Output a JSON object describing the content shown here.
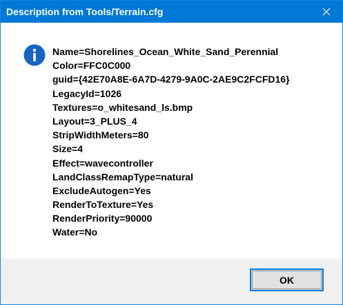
{
  "window": {
    "title": "Description from Tools/Terrain.cfg",
    "close_icon": "close-icon"
  },
  "message": {
    "icon": "info-icon",
    "icon_color": "#1565c0",
    "lines": [
      "Name=Shorelines_Ocean_White_Sand_Perennial",
      "Color=FFC0C000",
      "guid={42E70A8E-6A7D-4279-9A0C-2AE9C2FCFD16}",
      "LegacyId=1026",
      "Textures=o_whitesand_ls.bmp",
      "Layout=3_PLUS_4",
      "StripWidthMeters=80",
      "Size=4",
      "Effect=wavecontroller",
      "LandClassRemapType=natural",
      "ExcludeAutogen=Yes",
      "RenderToTexture=Yes",
      "RenderPriority=90000",
      "Water=No"
    ]
  },
  "buttons": {
    "ok_label": "OK"
  },
  "colors": {
    "titlebar": "#0078d7",
    "footer": "#f0f0f0",
    "button_border": "#0078d7"
  }
}
